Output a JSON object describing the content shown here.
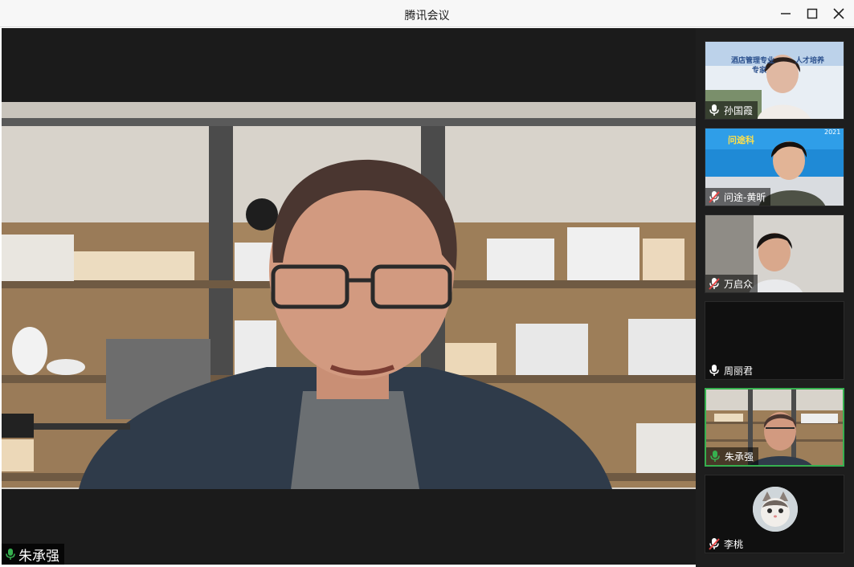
{
  "window": {
    "title": "腾讯会议",
    "minimize_label": "—",
    "maximize_label": "□",
    "close_label": "✕"
  },
  "main_speaker": {
    "name": "朱承强",
    "mic": "on"
  },
  "participants": [
    {
      "name": "孙国霞",
      "mic": "on",
      "background_text": [
        "酒店管理专业",
        "人才培养",
        "专家"
      ]
    },
    {
      "name": "问途-黄昕",
      "mic": "muted",
      "background_text": [
        "问途科",
        "2021"
      ]
    },
    {
      "name": "万启众",
      "mic": "muted"
    },
    {
      "name": "周丽君",
      "mic": "on"
    },
    {
      "name": "朱承强",
      "mic": "on",
      "active": true
    },
    {
      "name": "李桃",
      "mic": "muted"
    }
  ],
  "colors": {
    "mic_on": "#36b04f",
    "mic_muted": "#e64545",
    "active_border": "#36b04f",
    "sidebar_bg": "#1e1e1e"
  }
}
